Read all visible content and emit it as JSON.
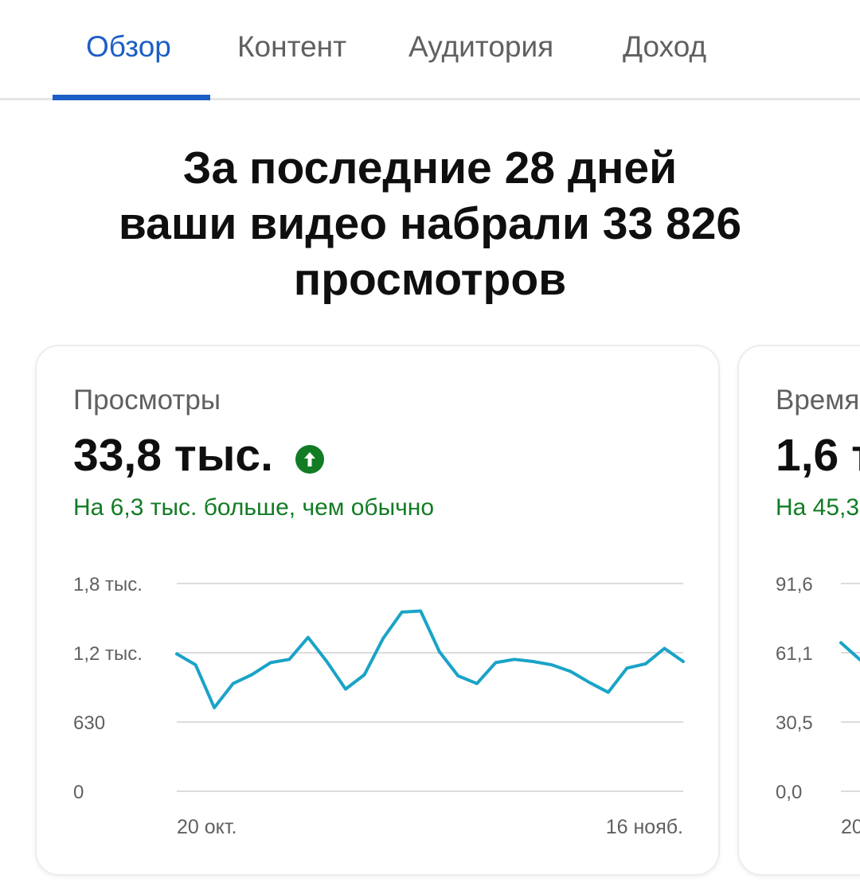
{
  "tabs": [
    {
      "label": "Обзор",
      "active": true
    },
    {
      "label": "Контент",
      "active": false
    },
    {
      "label": "Аудитория",
      "active": false
    },
    {
      "label": "Доход",
      "active": false
    }
  ],
  "headline": {
    "line1": "За последние 28 дней",
    "line2": "ваши видео набрали 33 826",
    "line3": "просмотров"
  },
  "cards": [
    {
      "title": "Просмотры",
      "value": "33,8 тыс.",
      "trend_icon": "arrow-up-circle-icon",
      "delta": "На 6,3 тыс. больше, чем обычно"
    },
    {
      "title": "Время",
      "value": "1,6 т",
      "delta": "На 45,3"
    }
  ],
  "colors": {
    "accent": "#1c5ec5",
    "positive": "#127c25",
    "line": "#1aa3c7"
  },
  "chart_data": [
    {
      "type": "line",
      "x": [
        "20 окт.",
        "21 окт.",
        "22 окт.",
        "23 окт.",
        "24 окт.",
        "25 окт.",
        "26 окт.",
        "27 окт.",
        "28 окт.",
        "29 окт.",
        "30 окт.",
        "31 окт.",
        "1 нояб.",
        "2 нояб.",
        "3 нояб.",
        "4 нояб.",
        "5 нояб.",
        "6 нояб.",
        "7 нояб.",
        "8 нояб.",
        "9 нояб.",
        "10 нояб.",
        "11 нояб.",
        "12 нояб.",
        "13 нояб.",
        "14 нояб.",
        "15 нояб.",
        "16 нояб."
      ],
      "x_tick_labels": [
        "20 окт.",
        "16 нояб."
      ],
      "y_tick_labels": [
        "0",
        "630",
        "1,2 тыс.",
        "1,8 тыс."
      ],
      "ylim": [
        0,
        1890
      ],
      "grid": true,
      "series": [
        {
          "values": [
            1250,
            1150,
            760,
            980,
            1060,
            1170,
            1200,
            1400,
            1180,
            930,
            1060,
            1390,
            1630,
            1640,
            1270,
            1050,
            980,
            1170,
            1200,
            1180,
            1150,
            1090,
            990,
            900,
            1120,
            1160,
            1300,
            1180
          ]
        }
      ]
    },
    {
      "type": "line",
      "x_tick_labels": [
        "20"
      ],
      "y_tick_labels": [
        "0,0",
        "30,5",
        "61,1",
        "91,6"
      ],
      "ylim": [
        0,
        91.6
      ],
      "grid": true,
      "series": [
        {
          "values": [
            65.5,
            58.0
          ]
        }
      ]
    }
  ]
}
